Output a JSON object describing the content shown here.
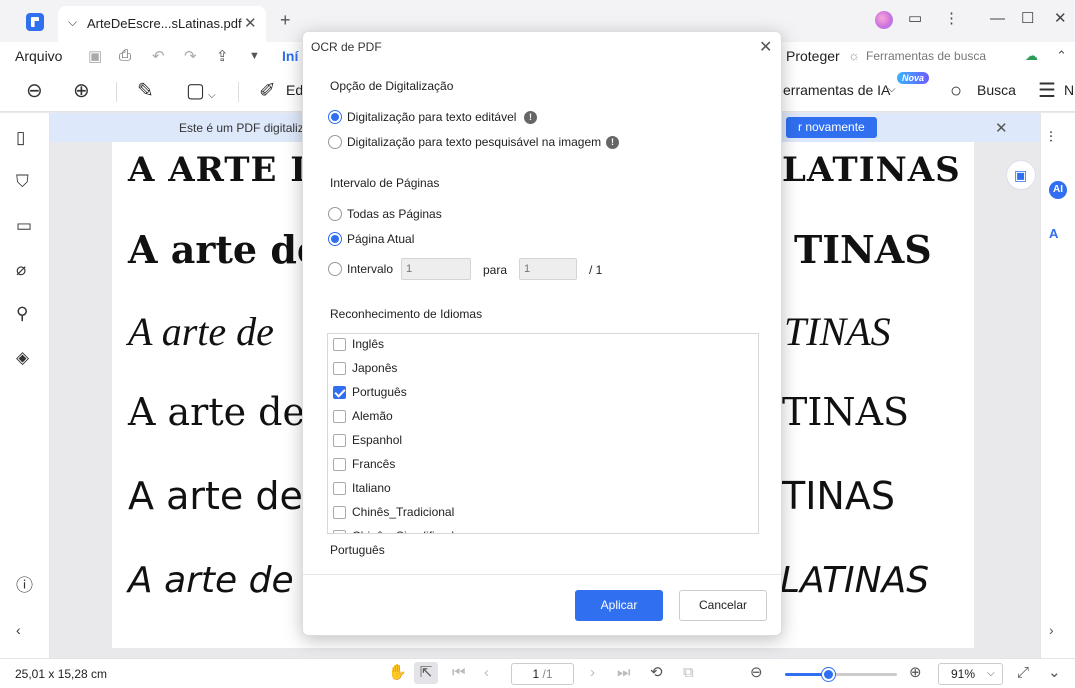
{
  "titlebar": {
    "tab_title": "ArteDeEscre...sLatinas.pdf",
    "new_tab": "+",
    "controls": [
      "—",
      "☐",
      "✕"
    ]
  },
  "menubar": {
    "arquivo": "Arquivo",
    "inicio": "Iní",
    "proteger": "Proteger",
    "ferramentas_busca": "Ferramentas de busca"
  },
  "toolbar": {
    "edit_label": "Ed",
    "ia_label": "erramentas de IA",
    "nova_badge": "Nova",
    "busca_label": "Busca",
    "more_label": "N"
  },
  "notification": {
    "text": "Este é um PDF digitaliz",
    "button": "r novamente"
  },
  "pdf": {
    "lines": [
      {
        "left": "A ARTE DE",
        "right": "LATINAS"
      },
      {
        "left": "A arte de",
        "right": "TINAS"
      },
      {
        "left": "A arte de",
        "right": "TINAS"
      },
      {
        "left": "A arte de",
        "right": "TINAS"
      },
      {
        "left": "A arte de",
        "right": "TINAS"
      },
      {
        "left": "A arte de",
        "right": "LATINAS"
      }
    ]
  },
  "dialog": {
    "title": "OCR de PDF",
    "scan_section": "Opção de Digitalização",
    "scan_options": [
      "Digitalização para texto editável",
      "Digitalização para texto pesquisável na imagem"
    ],
    "scan_selected": 0,
    "range_section": "Intervalo de Páginas",
    "range_all": "Todas as Páginas",
    "range_current": "Página Atual",
    "range_interval": "Intervalo",
    "range_from_placeholder": "1",
    "range_to_label": "para",
    "range_to_placeholder": "1",
    "range_total": "/ 1",
    "lang_section": "Reconhecimento de Idiomas",
    "languages": [
      {
        "label": "Inglês",
        "checked": false
      },
      {
        "label": "Japonês",
        "checked": false
      },
      {
        "label": "Português",
        "checked": true
      },
      {
        "label": "Alemão",
        "checked": false
      },
      {
        "label": "Espanhol",
        "checked": false
      },
      {
        "label": "Francês",
        "checked": false
      },
      {
        "label": "Italiano",
        "checked": false
      },
      {
        "label": "Chinês_Tradicional",
        "checked": false
      },
      {
        "label": "Chinês_Simplificado",
        "checked": false
      }
    ],
    "selected_languages_text": "Português",
    "apply": "Aplicar",
    "cancel": "Cancelar"
  },
  "statusbar": {
    "dimensions": "25,01 x 15,28 cm",
    "page_current": "1",
    "page_total": "/1",
    "zoom": "91%",
    "zoom_fraction": 0.38
  },
  "colors": {
    "accent": "#2f6ff0",
    "notify_bg": "#dde8fa"
  }
}
